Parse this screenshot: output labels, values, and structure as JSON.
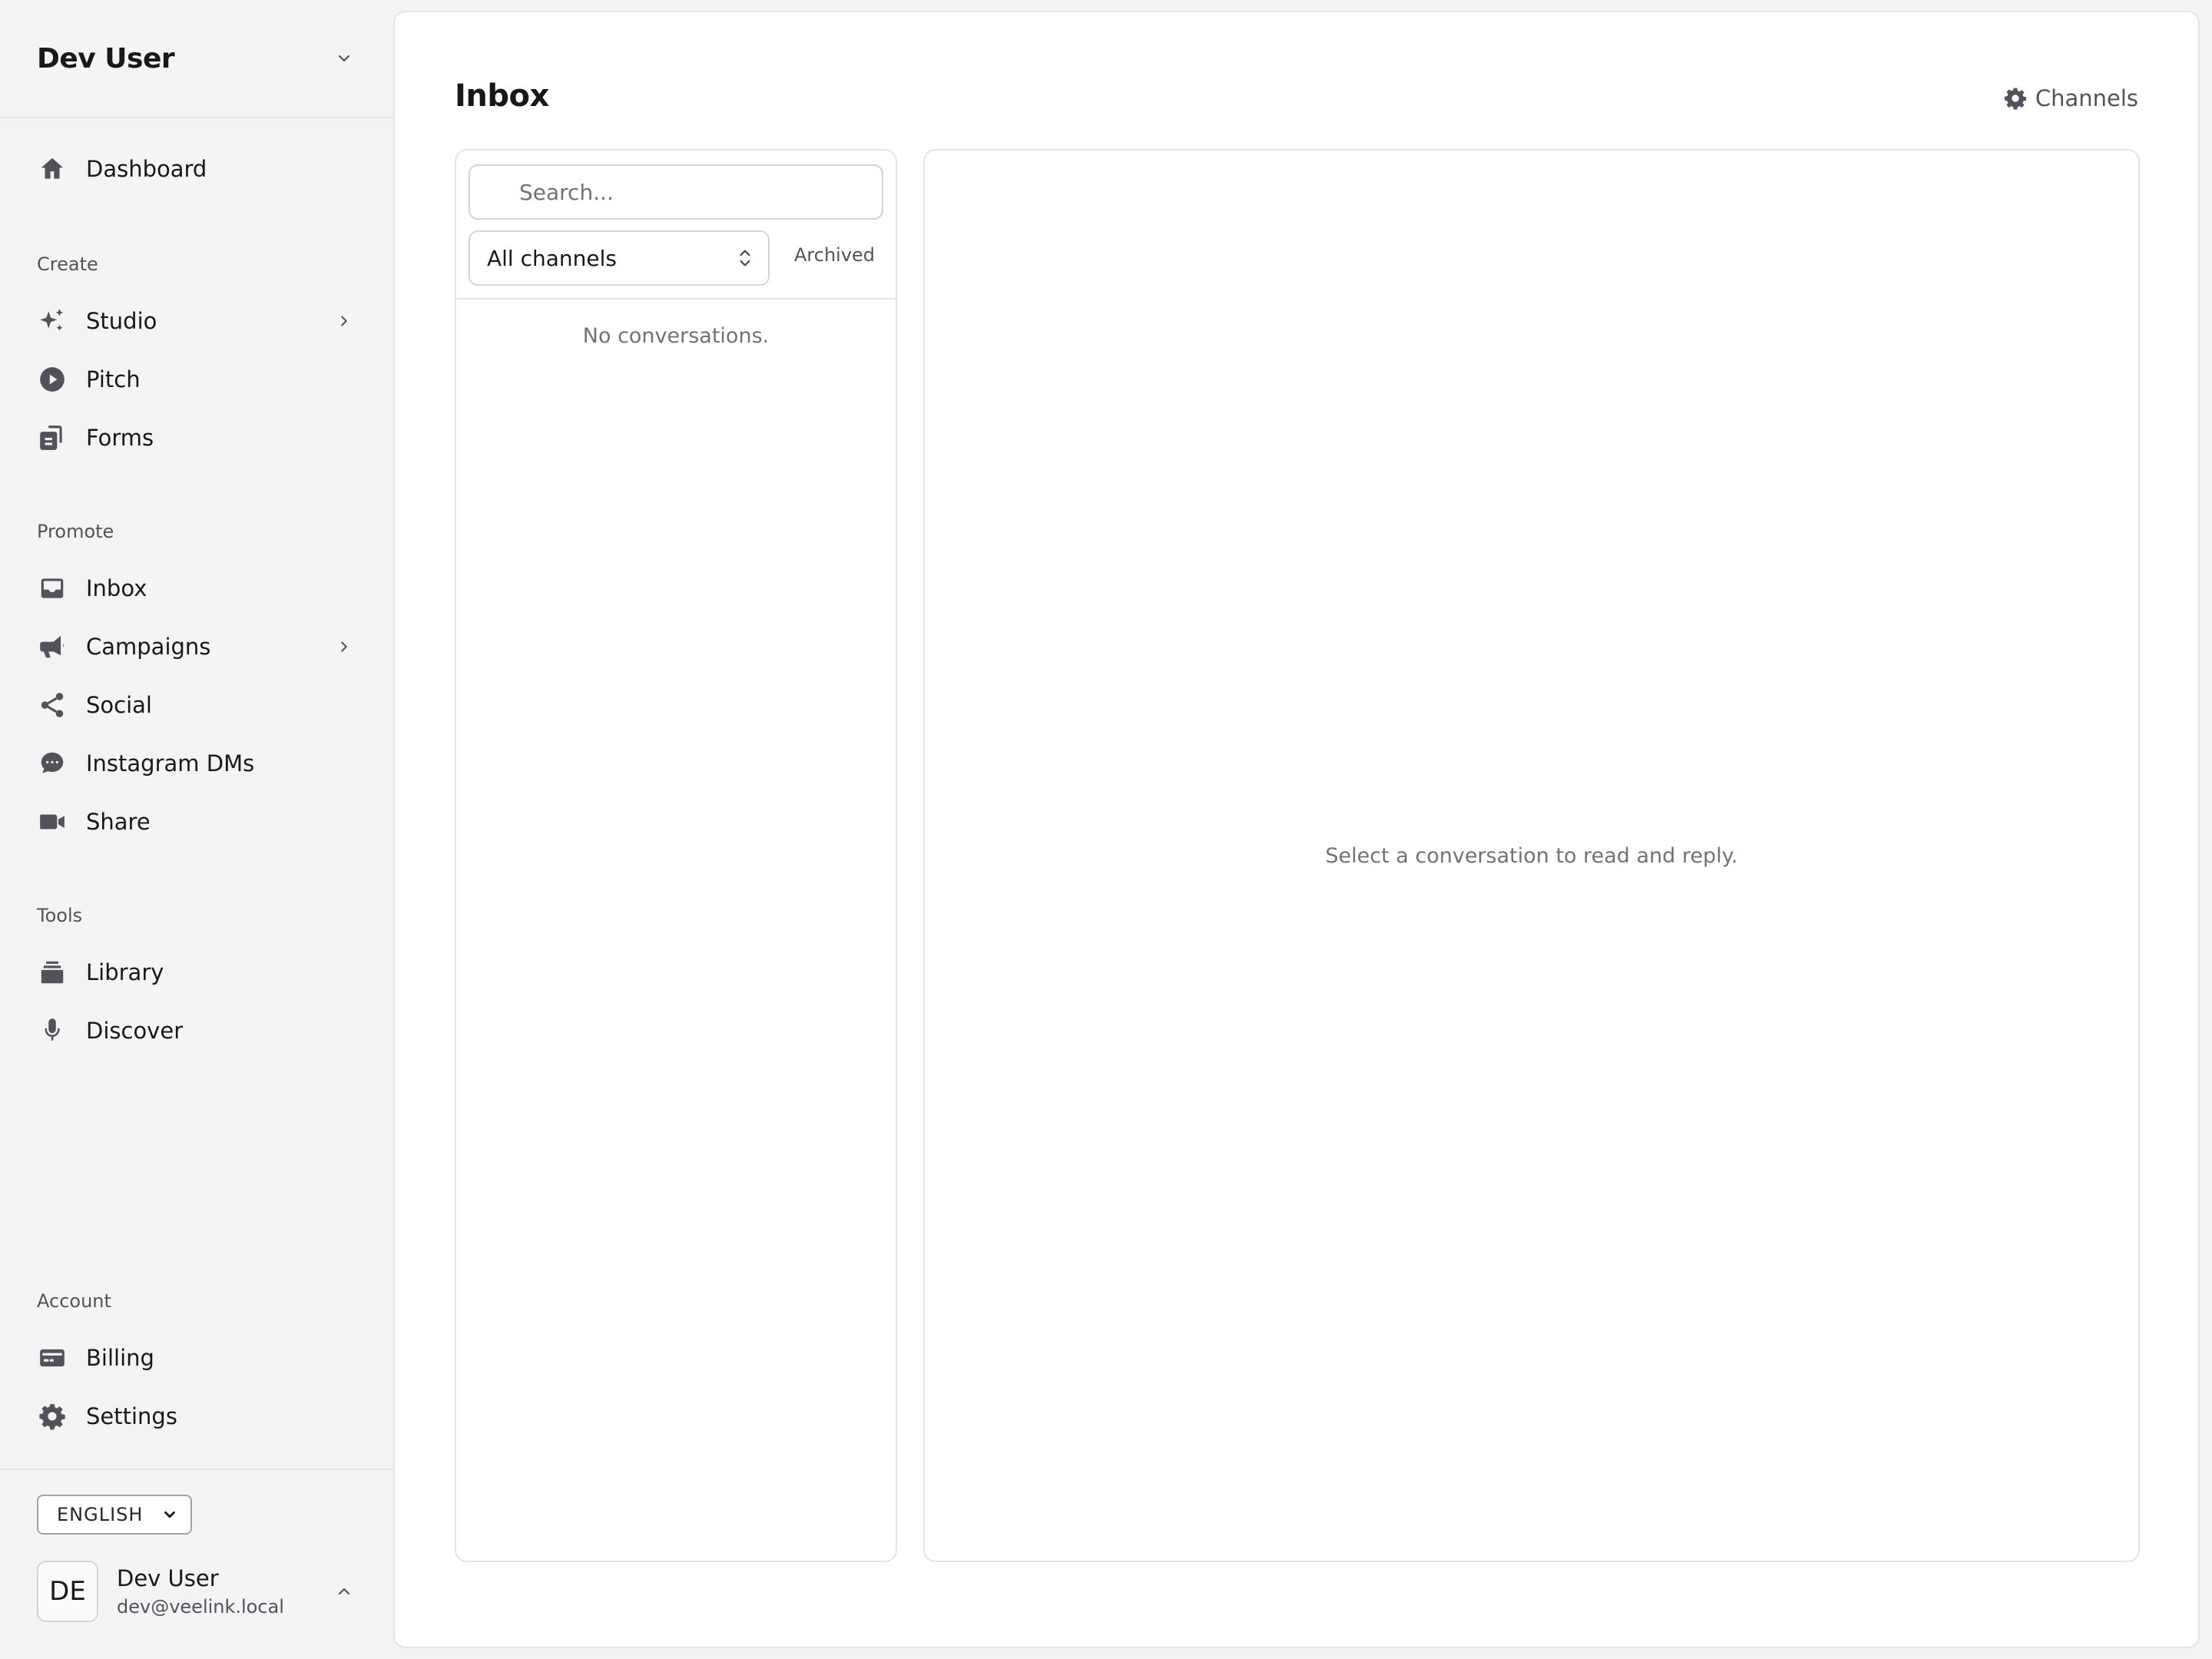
{
  "workspace": {
    "name": "Dev User"
  },
  "nav": {
    "dashboard": "Dashboard",
    "sections": {
      "create": "Create",
      "promote": "Promote",
      "tools": "Tools",
      "account": "Account"
    },
    "studio": "Studio",
    "pitch": "Pitch",
    "forms": "Forms",
    "inbox": "Inbox",
    "campaigns": "Campaigns",
    "social": "Social",
    "instagram_dms": "Instagram DMs",
    "share": "Share",
    "library": "Library",
    "discover": "Discover",
    "billing": "Billing",
    "settings": "Settings"
  },
  "language": {
    "selected": "ENGLISH"
  },
  "user": {
    "initials": "DE",
    "name": "Dev User",
    "email": "dev@veelink.local"
  },
  "main": {
    "title": "Inbox",
    "channels_button": "Channels",
    "search_placeholder": "Search...",
    "channel_filter": "All channels",
    "archived_label": "Archived",
    "empty_list": "No conversations.",
    "empty_detail": "Select a conversation to read and reply."
  },
  "colors": {
    "icon": "#52525b",
    "muted_text": "#71717a",
    "border": "#e4e4e7"
  }
}
